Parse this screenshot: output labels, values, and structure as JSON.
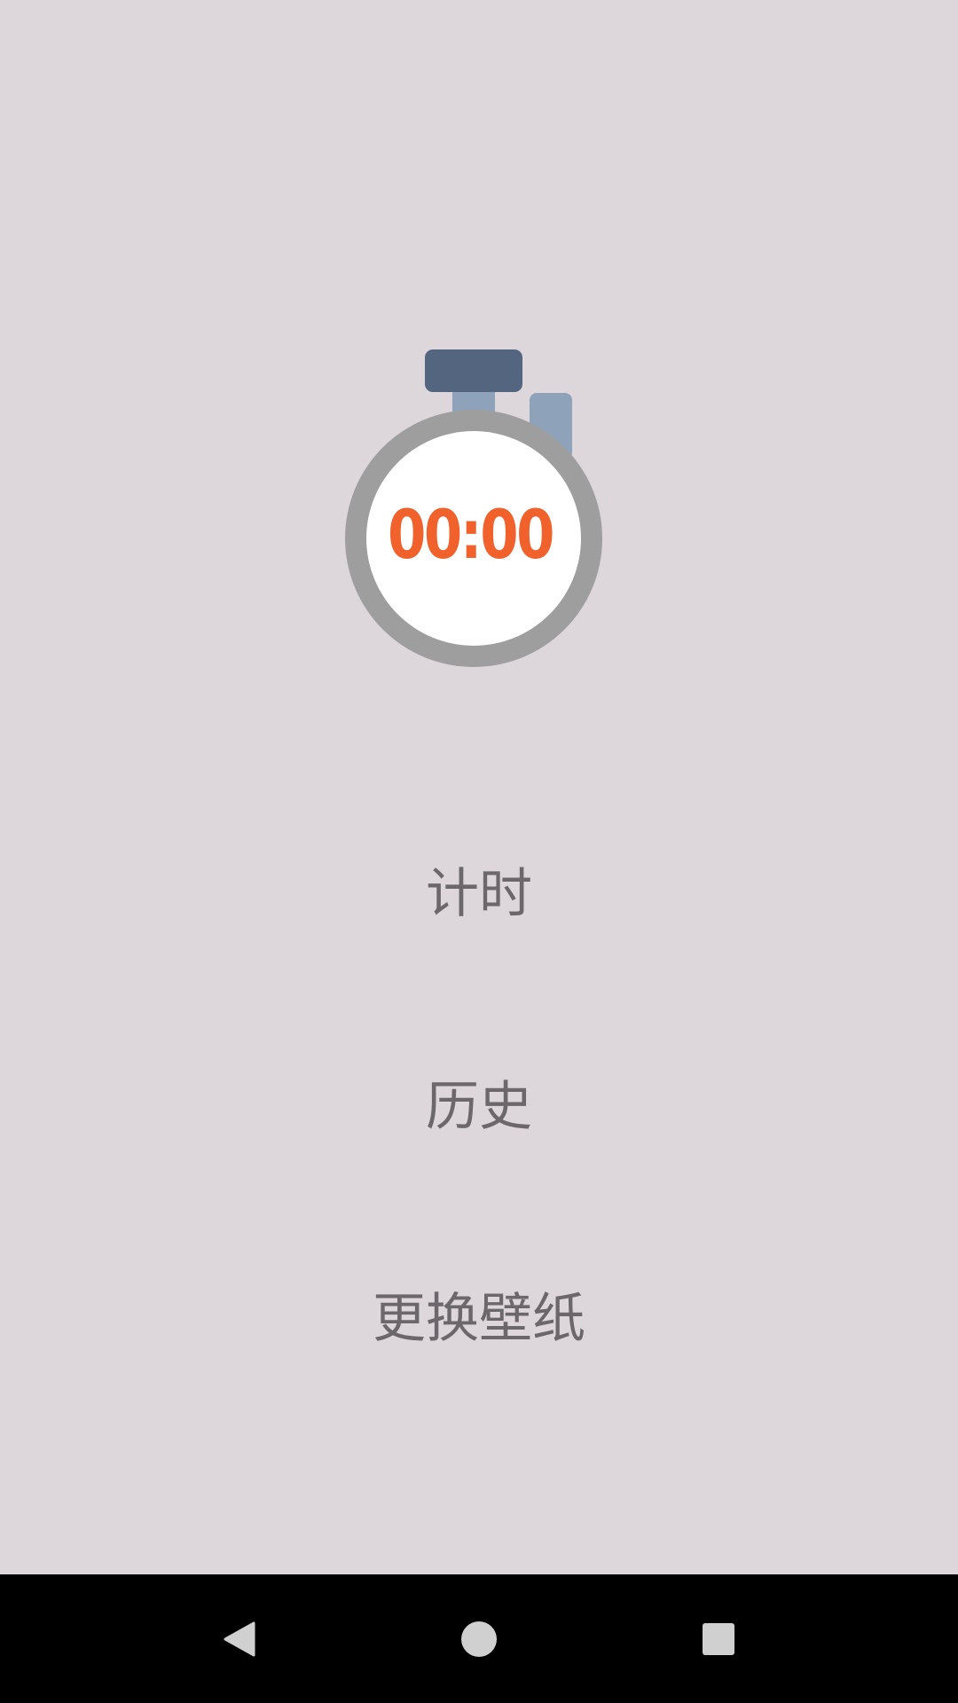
{
  "stopwatch": {
    "time_display": "00:00",
    "colors": {
      "ring": "#9e9e9e",
      "face": "#ffffff",
      "digits": "#f0612c",
      "crown": "#54657f",
      "stem": "#8ea3b9"
    }
  },
  "menu": {
    "timing_label": "计时",
    "history_label": "历史",
    "wallpaper_label": "更换壁纸"
  },
  "navbar": {
    "back_icon": "back-triangle-icon",
    "home_icon": "home-circle-icon",
    "recents_icon": "recents-square-icon"
  }
}
